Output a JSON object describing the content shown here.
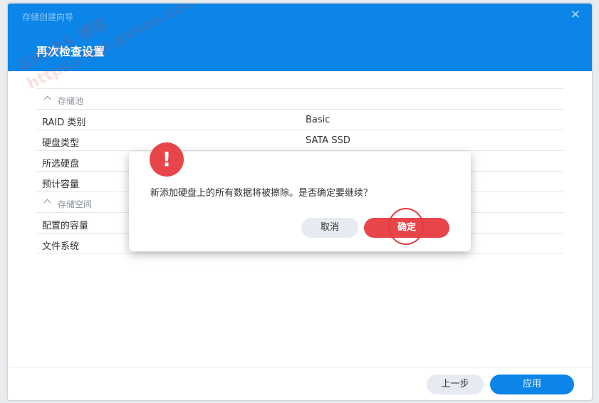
{
  "window": {
    "title": "存储创建向导",
    "close_symbol": "✕",
    "step_title": "再次检查设置",
    "watermark_lines": [
      "GXNAS 博客",
      "https://wp.gxnas.com"
    ]
  },
  "summary": {
    "rows": [
      {
        "type": "section",
        "label": "存储池"
      },
      {
        "type": "item",
        "label": "RAID 类别",
        "value": "Basic"
      },
      {
        "type": "item",
        "label": "硬盘类型",
        "value": "SATA SSD"
      },
      {
        "type": "item",
        "label": "所选硬盘",
        "value": ""
      },
      {
        "type": "item",
        "label": "预计容量",
        "value": ""
      },
      {
        "type": "section",
        "label": "存储空间"
      },
      {
        "type": "item",
        "label": "配置的容量",
        "value": ""
      },
      {
        "type": "item",
        "label": "文件系统",
        "value": ""
      }
    ]
  },
  "footer": {
    "prev_label": "上一步",
    "apply_label": "应用"
  },
  "dialog": {
    "icon": "!",
    "message": "新添加硬盘上的所有数据将被擦除。是否确定要继续？",
    "cancel_label": "取消",
    "ok_label": "确定"
  },
  "colors": {
    "primary": "#0b85e8",
    "danger": "#e8454a"
  }
}
